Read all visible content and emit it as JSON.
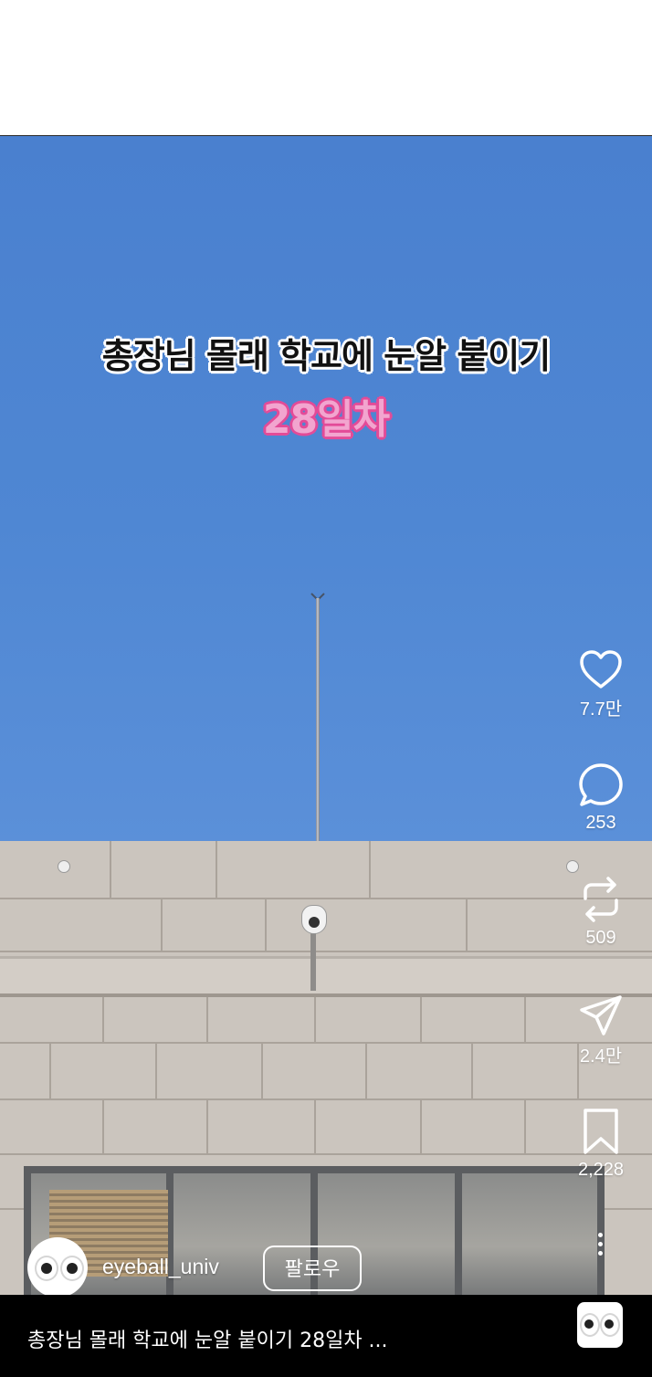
{
  "video": {
    "title_line1": "총장님 몰래 학교에 눈알 붙이기",
    "title_line2": "28일차"
  },
  "actions": {
    "like_count": "7.7만",
    "comment_count": "253",
    "repost_count": "509",
    "share_count": "2.4만",
    "save_count": "2,228"
  },
  "account": {
    "username": "eyeball_univ",
    "follow_label": "팔로우"
  },
  "caption": {
    "text": "총장님 몰래 학교에 눈알 붙이기 28일차 ..."
  },
  "icons": {
    "like": "heart-icon",
    "comment": "comment-icon",
    "repost": "repost-icon",
    "share": "paper-plane-icon",
    "save": "bookmark-icon",
    "more": "more-vertical-icon"
  }
}
